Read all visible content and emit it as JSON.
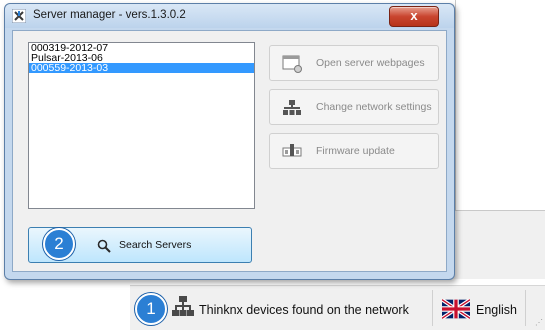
{
  "window": {
    "title": "Server manager - vers.1.3.0.2",
    "close_label": "x"
  },
  "server_list": {
    "items": [
      {
        "label": "000319-2012-07",
        "selected": false
      },
      {
        "label": "Pulsar-2013-06",
        "selected": false
      },
      {
        "label": "000559-2013-03",
        "selected": true
      }
    ]
  },
  "actions": {
    "open_webpages": "Open server webpages",
    "change_network": "Change network settings",
    "firmware_update": "Firmware update",
    "search_servers": "Search Servers"
  },
  "statusbar": {
    "devices_text": "Thinknx devices found on the network",
    "language": "English"
  },
  "callouts": {
    "one": "1",
    "two": "2"
  },
  "colors": {
    "selection": "#3399ff",
    "callout": "#2b7fd4",
    "close_button": "#c9452f",
    "search_button": "#bee6fd"
  },
  "icons": {
    "app": "app-logo-icon",
    "close": "close-icon",
    "webpages": "browser-window-icon",
    "network": "network-tree-icon",
    "firmware": "firmware-chip-icon",
    "search": "magnifier-icon",
    "devices": "network-devices-icon",
    "language": "uk-flag-icon"
  }
}
